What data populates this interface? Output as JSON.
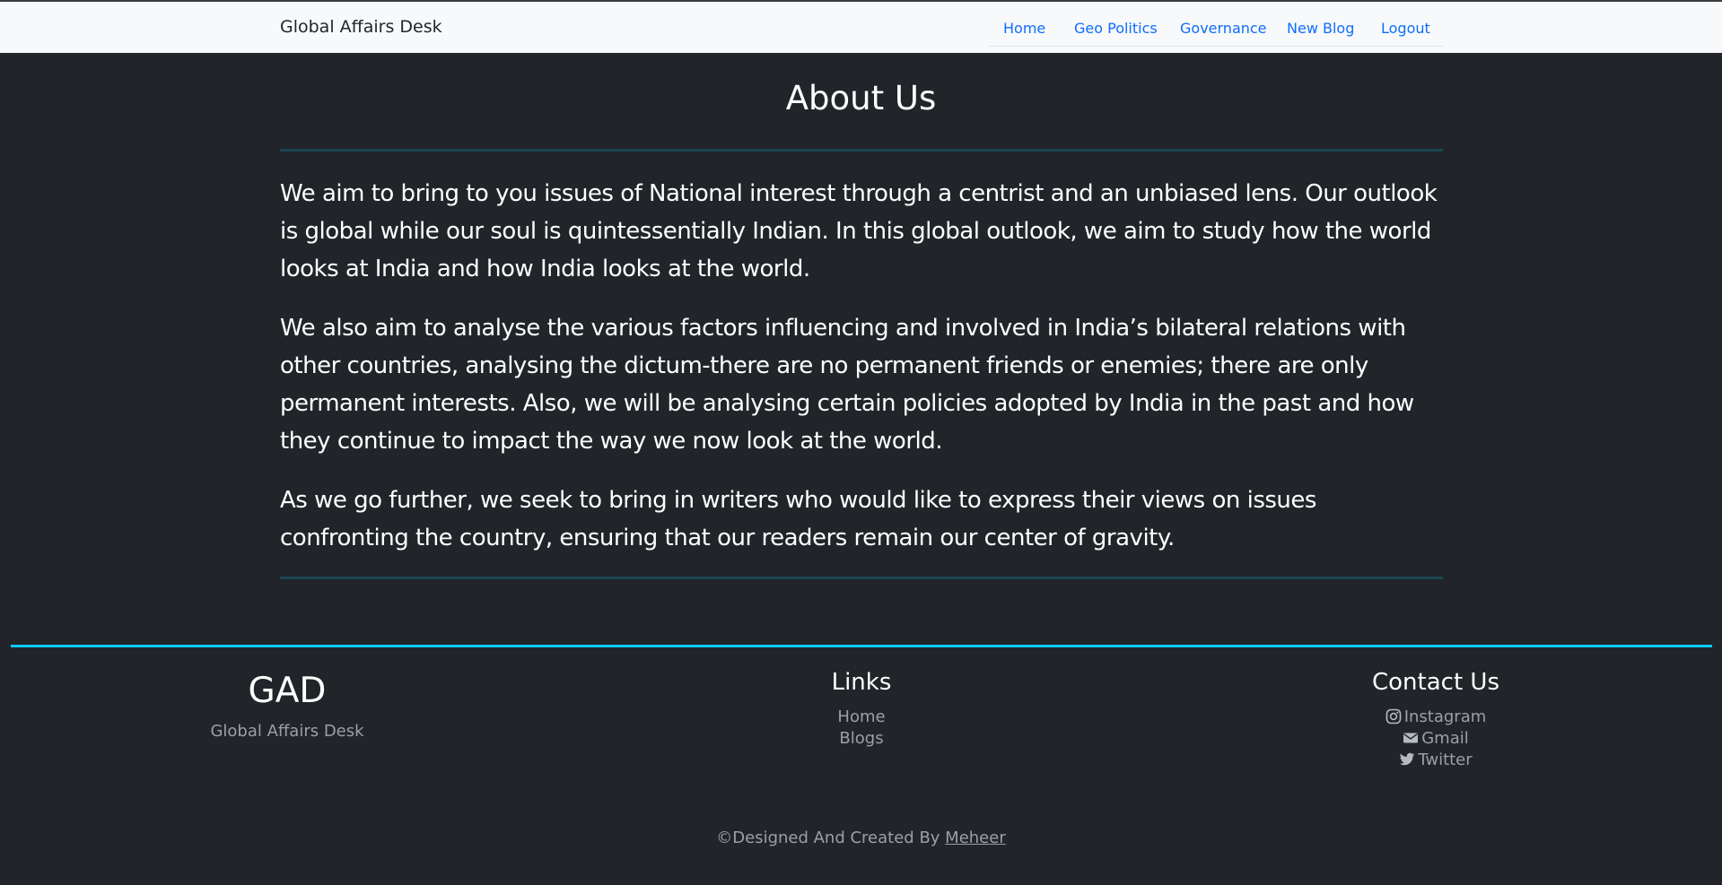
{
  "navbar": {
    "brand": "Global Affairs Desk",
    "links": [
      "Home",
      "Geo Politics",
      "Governance",
      "New Blog",
      "Logout"
    ],
    "link_color": "#0d6efd"
  },
  "main": {
    "title": "About Us",
    "paragraphs": [
      "We aim to bring to you issues of National interest through a centrist and an unbiased lens. Our outlook is global while our soul is quintessentially Indian. In this global outlook, we aim to study how the world looks at India and how India looks at the world.",
      "We also aim to analyse the various factors influencing and involved in India’s bilateral relations with other countries, analysing the dictum-there are no permanent friends or enemies; there are only permanent interests. Also, we will be analysing certain policies adopted by India in the past and how they continue to impact the way we now look at the world.",
      "As we go further, we seek to bring in writers who would like to express their views on issues confronting the country, ensuring that our readers remain our center of gravity."
    ]
  },
  "footer": {
    "logo": "GAD",
    "logo_subtitle": "Global Affairs Desk",
    "links_heading": "Links",
    "links": [
      "Home",
      "Blogs"
    ],
    "contact_heading": "Contact Us",
    "contact": [
      {
        "icon": "instagram-icon",
        "label": "Instagram"
      },
      {
        "icon": "envelope-icon",
        "label": "Gmail"
      },
      {
        "icon": "twitter-icon",
        "label": "Twitter"
      }
    ],
    "copyright_prefix": "©Designed And Created By ",
    "copyright_author": "Meheer",
    "accent_color": "#0dcaf0"
  }
}
